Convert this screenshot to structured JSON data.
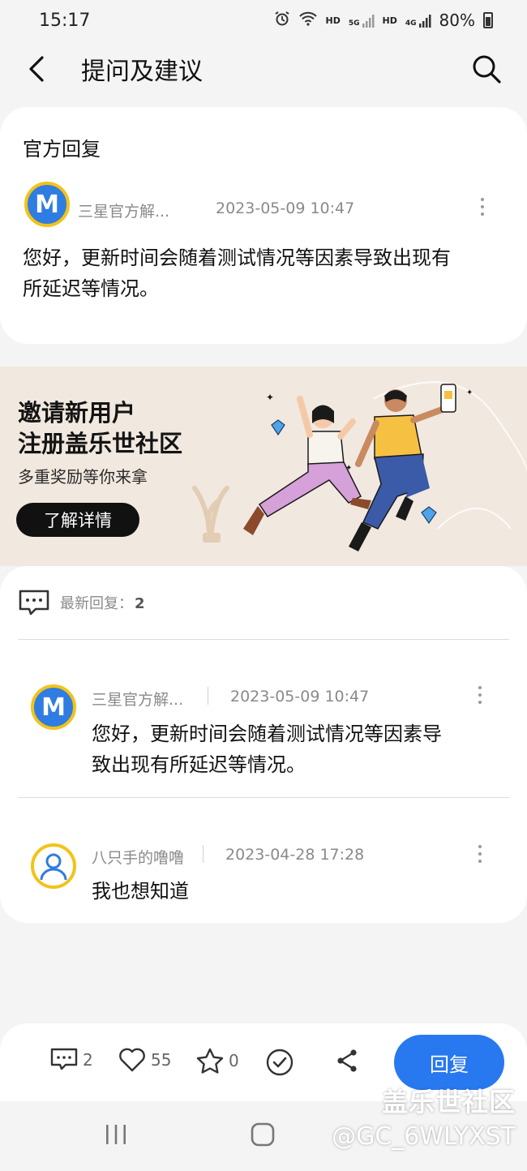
{
  "status_bar": {
    "time": "15:17",
    "hd1": "HD",
    "net1": "5G",
    "hd2": "HD",
    "net2": "4G",
    "battery": "80%"
  },
  "header": {
    "title": "提问及建议"
  },
  "official_reply": {
    "section_label": "官方回复",
    "author": "三星官方解...",
    "time": "2023-05-09 10:47",
    "text_line1": "您好，更新时间会随着测试情况等因素导致出现有",
    "text_line2": "所延迟等情况。"
  },
  "banner": {
    "title_line1": "邀请新用户",
    "title_line2": "注册盖乐世社区",
    "subtitle": "多重奖励等你来拿",
    "button_label": "了解详情"
  },
  "latest_replies": {
    "label": "最新回复：",
    "count": "2",
    "items": [
      {
        "author": "三星官方解...",
        "time": "2023-05-09 10:47",
        "text_line1": "您好，更新时间会随着测试情况等因素导",
        "text_line2": "致出现有所延迟等情况。"
      },
      {
        "author": "八只手的噜噜",
        "time": "2023-04-28 17:28",
        "text_line1": "我也想知道"
      }
    ]
  },
  "action_bar": {
    "comments": "2",
    "likes": "55",
    "favorites": "0",
    "reply_label": "回复"
  },
  "watermark": {
    "line1": "盖乐世社区",
    "line2": "@GC_6WLYXST"
  },
  "colors": {
    "accent": "#2878f0",
    "avatar_ring": "#f2c318",
    "avatar_fill": "#2f7ce3",
    "banner_bg": "#f1e8df"
  }
}
